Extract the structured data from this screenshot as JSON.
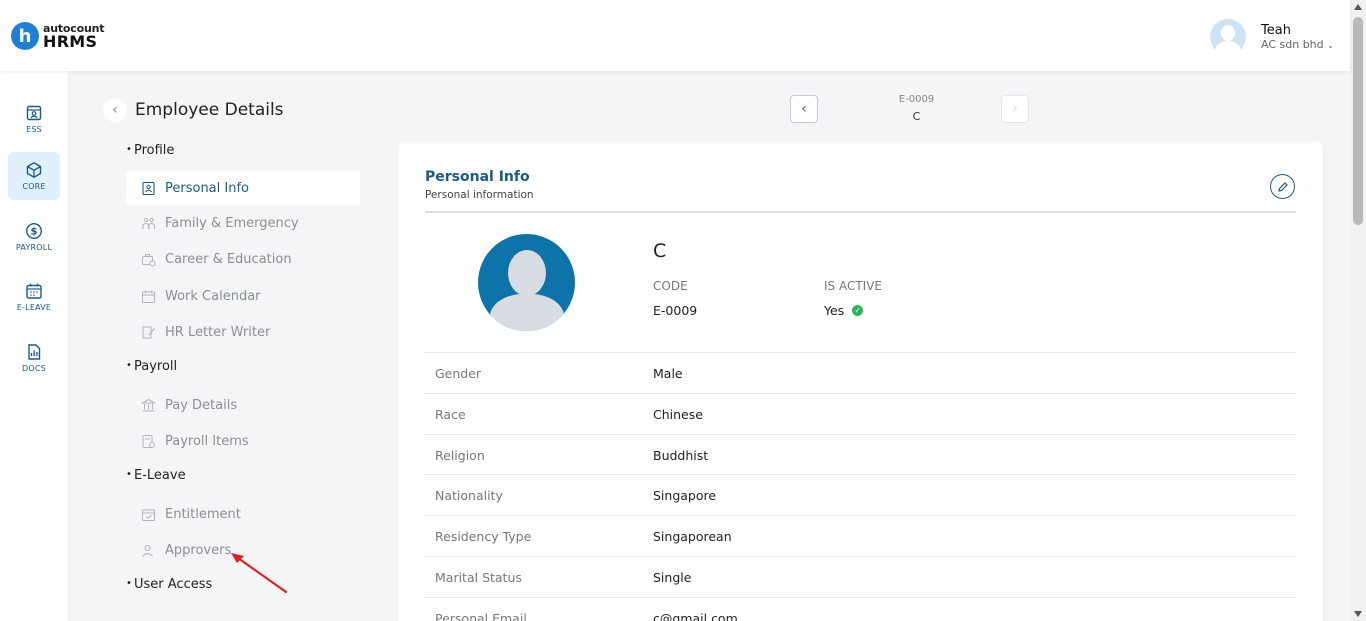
{
  "app": {
    "logo_small": "autocount",
    "logo_big": "HRMS",
    "logo_letter": "h"
  },
  "user": {
    "name": "Teah",
    "company": "AC sdn bhd"
  },
  "rail": {
    "items": [
      {
        "label": "ESS",
        "icon": "ess-icon"
      },
      {
        "label": "CORE",
        "icon": "core-icon"
      },
      {
        "label": "PAYROLL",
        "icon": "payroll-icon"
      },
      {
        "label": "E-LEAVE",
        "icon": "calendar-icon"
      },
      {
        "label": "DOCS",
        "icon": "docs-icon"
      }
    ]
  },
  "page": {
    "title": "Employee Details"
  },
  "subnav": {
    "profile": "Profile",
    "personal_info": "Personal Info",
    "family": "Family & Emergency",
    "career": "Career & Education",
    "work_calendar": "Work Calendar",
    "hr_letter": "HR Letter Writer",
    "payroll": "Payroll",
    "pay_details": "Pay Details",
    "payroll_items": "Payroll Items",
    "eleave": "E-Leave",
    "entitlement": "Entitlement",
    "approvers": "Approvers",
    "user_access": "User Access"
  },
  "employee_nav": {
    "code": "E-0009",
    "name": "C"
  },
  "card": {
    "title": "Personal Info",
    "subtitle": "Personal information",
    "employee_name": "C",
    "code_label": "CODE",
    "code_value": "E-0009",
    "active_label": "IS ACTIVE",
    "active_value": "Yes",
    "rows": [
      {
        "label": "Gender",
        "value": "Male"
      },
      {
        "label": "Race",
        "value": "Chinese"
      },
      {
        "label": "Religion",
        "value": "Buddhist"
      },
      {
        "label": "Nationality",
        "value": "Singapore"
      },
      {
        "label": "Residency Type",
        "value": "Singaporean"
      },
      {
        "label": "Marital Status",
        "value": "Single"
      },
      {
        "label": "Personal Email",
        "value": "c@gmail.com"
      }
    ]
  },
  "colors": {
    "accent": "#1a5b86",
    "rail_active": "#dff0fb",
    "avatar": "#0d73a8",
    "active_check": "#2bb55a",
    "annotation_arrow": "#e02020"
  }
}
